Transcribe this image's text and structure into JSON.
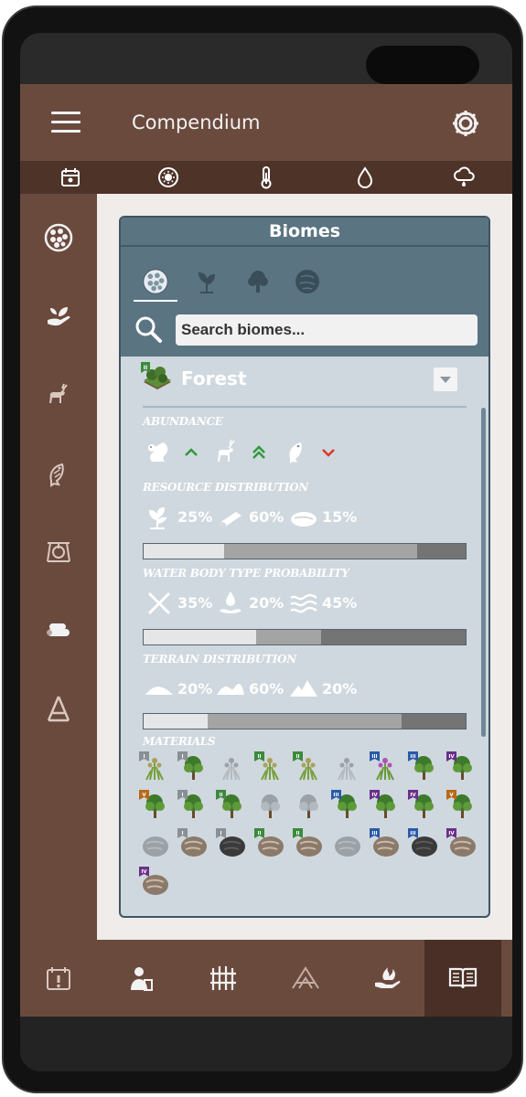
{
  "app": {
    "title": "Compendium",
    "accent": "#6b4a3e",
    "header_icons": [
      "menu-icon",
      "gear-icon"
    ],
    "weather_icons": [
      "calendar-icon",
      "sun-icon",
      "thermometer-icon",
      "water-drop-icon",
      "rain-cloud-icon"
    ]
  },
  "sidebar": {
    "items": [
      {
        "icon": "biome-globe-icon"
      },
      {
        "icon": "plant-hand-icon"
      },
      {
        "icon": "deer-icon"
      },
      {
        "icon": "fish-icon"
      },
      {
        "icon": "trap-icon"
      },
      {
        "icon": "logs-icon"
      },
      {
        "icon": "tripod-icon"
      }
    ]
  },
  "panel": {
    "title": "Biomes",
    "tabs": [
      {
        "icon": "biome-globe-icon",
        "active": true
      },
      {
        "icon": "plant-icon",
        "active": false
      },
      {
        "icon": "tree-icon",
        "active": false
      },
      {
        "icon": "rock-icon",
        "active": false
      }
    ],
    "search_placeholder": "Search biomes..."
  },
  "biome": {
    "name": "Forest",
    "tier_badge": "II",
    "sections": {
      "abundance": "ABUNDANCE",
      "resource": "RESOURCE DISTRIBUTION",
      "water": "WATER BODY TYPE PROBABILITY",
      "terrain": "TERRAIN DISTRIBUTION",
      "materials": "MATERIALS"
    },
    "abundance": [
      {
        "icon": "squirrel-icon",
        "trend": "up"
      },
      {
        "icon": "deer-icon",
        "trend": "double-up"
      },
      {
        "icon": "fish-icon",
        "trend": "down"
      }
    ],
    "resource_distribution": [
      {
        "icon": "sprout-icon",
        "value": "25%",
        "fraction": 0.25,
        "color": "#e4e6e8"
      },
      {
        "icon": "log-icon",
        "value": "60%",
        "fraction": 0.6,
        "color": "#a4a4a4"
      },
      {
        "icon": "stone-icon",
        "value": "15%",
        "fraction": 0.15,
        "color": "#747474"
      }
    ],
    "water_body": [
      {
        "icon": "none-x-icon",
        "value": "35%",
        "fraction": 0.35,
        "color": "#e4e6e8"
      },
      {
        "icon": "pond-drop-icon",
        "value": "20%",
        "fraction": 0.2,
        "color": "#a4a4a4"
      },
      {
        "icon": "waves-icon",
        "value": "45%",
        "fraction": 0.45,
        "color": "#747474"
      }
    ],
    "terrain": [
      {
        "icon": "flat-hill-icon",
        "value": "20%",
        "fraction": 0.2,
        "color": "#e4e6e8"
      },
      {
        "icon": "hills-icon",
        "value": "60%",
        "fraction": 0.6,
        "color": "#a4a4a4"
      },
      {
        "icon": "mountain-icon",
        "value": "20%",
        "fraction": 0.2,
        "color": "#747474"
      }
    ],
    "materials": [
      {
        "icon": "grass-icon",
        "badge": "I",
        "badge_color": "#8a8f93"
      },
      {
        "icon": "bush-icon",
        "badge": "I",
        "badge_color": "#8a8f93"
      },
      {
        "icon": "lavender-icon",
        "badge": "",
        "badge_color": ""
      },
      {
        "icon": "flower-plant-icon",
        "badge": "II",
        "badge_color": "#3c8a3c"
      },
      {
        "icon": "wheat-icon",
        "badge": "II",
        "badge_color": "#3c8a3c"
      },
      {
        "icon": "silver-plant-icon",
        "badge": "",
        "badge_color": ""
      },
      {
        "icon": "pink-flower-icon",
        "badge": "III",
        "badge_color": "#2a5aa8"
      },
      {
        "icon": "shrub-icon",
        "badge": "III",
        "badge_color": "#2a5aa8"
      },
      {
        "icon": "fern-icon",
        "badge": "IV",
        "badge_color": "#6a2f8a"
      },
      {
        "icon": "bush-icon",
        "badge": "V",
        "badge_color": "#b66a1a"
      },
      {
        "icon": "oak-tree-icon",
        "badge": "I",
        "badge_color": "#8a8f93"
      },
      {
        "icon": "pine-tree-icon",
        "badge": "II",
        "badge_color": "#3c8a3c"
      },
      {
        "icon": "fir-tree-gray-icon",
        "badge": "",
        "badge_color": ""
      },
      {
        "icon": "round-tree-gray-icon",
        "badge": "",
        "badge_color": ""
      },
      {
        "icon": "oak-tree-icon",
        "badge": "III",
        "badge_color": "#2a5aa8"
      },
      {
        "icon": "oak-tree-icon",
        "badge": "IV",
        "badge_color": "#6a2f8a"
      },
      {
        "icon": "oak-tree-icon",
        "badge": "IV",
        "badge_color": "#6a2f8a"
      },
      {
        "icon": "oak-tree-icon",
        "badge": "V",
        "badge_color": "#b66a1a"
      },
      {
        "icon": "stone-gray-icon",
        "badge": "",
        "badge_color": ""
      },
      {
        "icon": "copper-rock-icon",
        "badge": "I",
        "badge_color": "#8a8f93"
      },
      {
        "icon": "coal-rock-icon",
        "badge": "I",
        "badge_color": "#8a8f93"
      },
      {
        "icon": "granite-rock-icon",
        "badge": "II",
        "badge_color": "#3c8a3c"
      },
      {
        "icon": "marble-rock-icon",
        "badge": "II",
        "badge_color": "#3c8a3c"
      },
      {
        "icon": "stone-gray-icon",
        "badge": "",
        "badge_color": ""
      },
      {
        "icon": "ore-rock-icon",
        "badge": "III",
        "badge_color": "#2a5aa8"
      },
      {
        "icon": "dark-rock-icon",
        "badge": "III",
        "badge_color": "#2a5aa8"
      },
      {
        "icon": "brown-rock-icon",
        "badge": "IV",
        "badge_color": "#6a2f8a"
      },
      {
        "icon": "pink-rock-icon",
        "badge": "IV",
        "badge_color": "#6a2f8a"
      }
    ]
  },
  "bottom_nav": [
    {
      "icon": "calendar-alert-icon",
      "active": false
    },
    {
      "icon": "survivor-icon",
      "active": false
    },
    {
      "icon": "fence-icon",
      "active": false
    },
    {
      "icon": "shelter-icon",
      "active": false
    },
    {
      "icon": "fire-hand-icon",
      "active": false
    },
    {
      "icon": "book-icon",
      "active": true
    }
  ]
}
